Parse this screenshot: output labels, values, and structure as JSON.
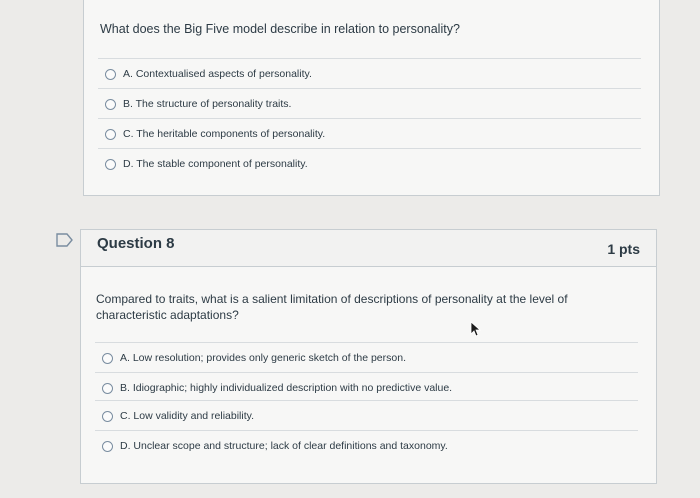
{
  "question7": {
    "text": "What does the Big Five model describe in relation to personality?",
    "answers": [
      "A. Contextualised aspects of personality.",
      "B. The structure of personality traits.",
      "C. The heritable components of personality.",
      "D. The stable component of personality."
    ]
  },
  "question8": {
    "title": "Question 8",
    "points": "1 pts",
    "text": "Compared to traits, what is a salient limitation of descriptions of personality at the level of characteristic adaptations?",
    "answers": [
      "A. Low resolution; provides only generic sketch of the person.",
      "B. Idiographic; highly individualized description with no predictive value.",
      "C. Low validity and reliability.",
      "D. Unclear scope and structure; lack of clear definitions and taxonomy."
    ]
  },
  "icons": {
    "flag": "flag-question-icon",
    "cursor": "mouse-pointer-icon"
  },
  "colors": {
    "background": "#ecebe9",
    "card": "#f7f7f6",
    "border": "#c7cdd1",
    "text": "#2d3b45",
    "radio": "#7a8da0"
  }
}
